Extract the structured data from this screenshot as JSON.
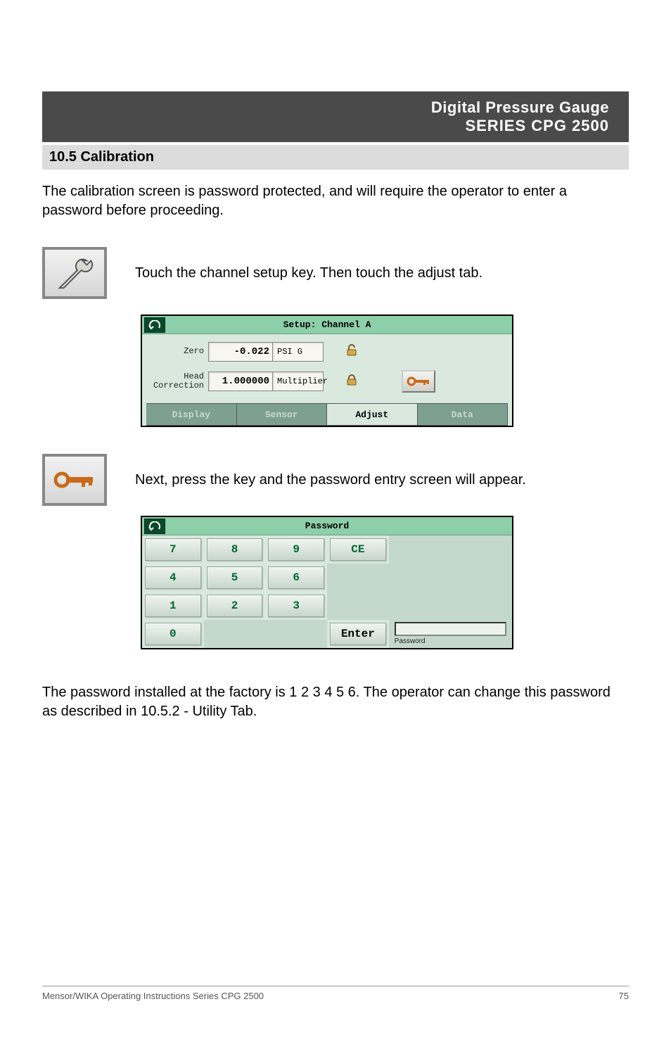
{
  "header": {
    "line1": "Digital Pressure Gauge",
    "line2": "SERIES CPG 2500"
  },
  "section_title": "10.5 Calibration",
  "intro_text": "The calibration screen is password protected, and will require the operator to enter a password before proceeding.",
  "step1_text": "Touch the channel setup key. Then touch the adjust tab.",
  "setup_screen": {
    "title": "Setup: Channel A",
    "zero_label": "Zero",
    "zero_value": "-0.022",
    "zero_unit": "PSI G",
    "head_label": "Head\nCorrection",
    "head_value": "1.000000",
    "head_unit": "Multiplier",
    "tabs": {
      "display": "Display",
      "sensor": "Sensor",
      "adjust": "Adjust",
      "data": "Data"
    }
  },
  "step2_text": "Next, press the key and the password entry screen will appear.",
  "password_screen": {
    "title": "Password",
    "keys": {
      "k7": "7",
      "k8": "8",
      "k9": "9",
      "ce": "CE",
      "k4": "4",
      "k5": "5",
      "k6": "6",
      "k1": "1",
      "k2": "2",
      "k3": "3",
      "k0": "0",
      "enter": "Enter"
    },
    "entry_label": "Password"
  },
  "closing_text": "The password installed at the factory is 1 2 3 4 5 6. The operator can change this password as described in 10.5.2 - Utility Tab.",
  "footer": {
    "left": "Mensor/WIKA Operating Instructions Series CPG 2500",
    "right": "75"
  }
}
